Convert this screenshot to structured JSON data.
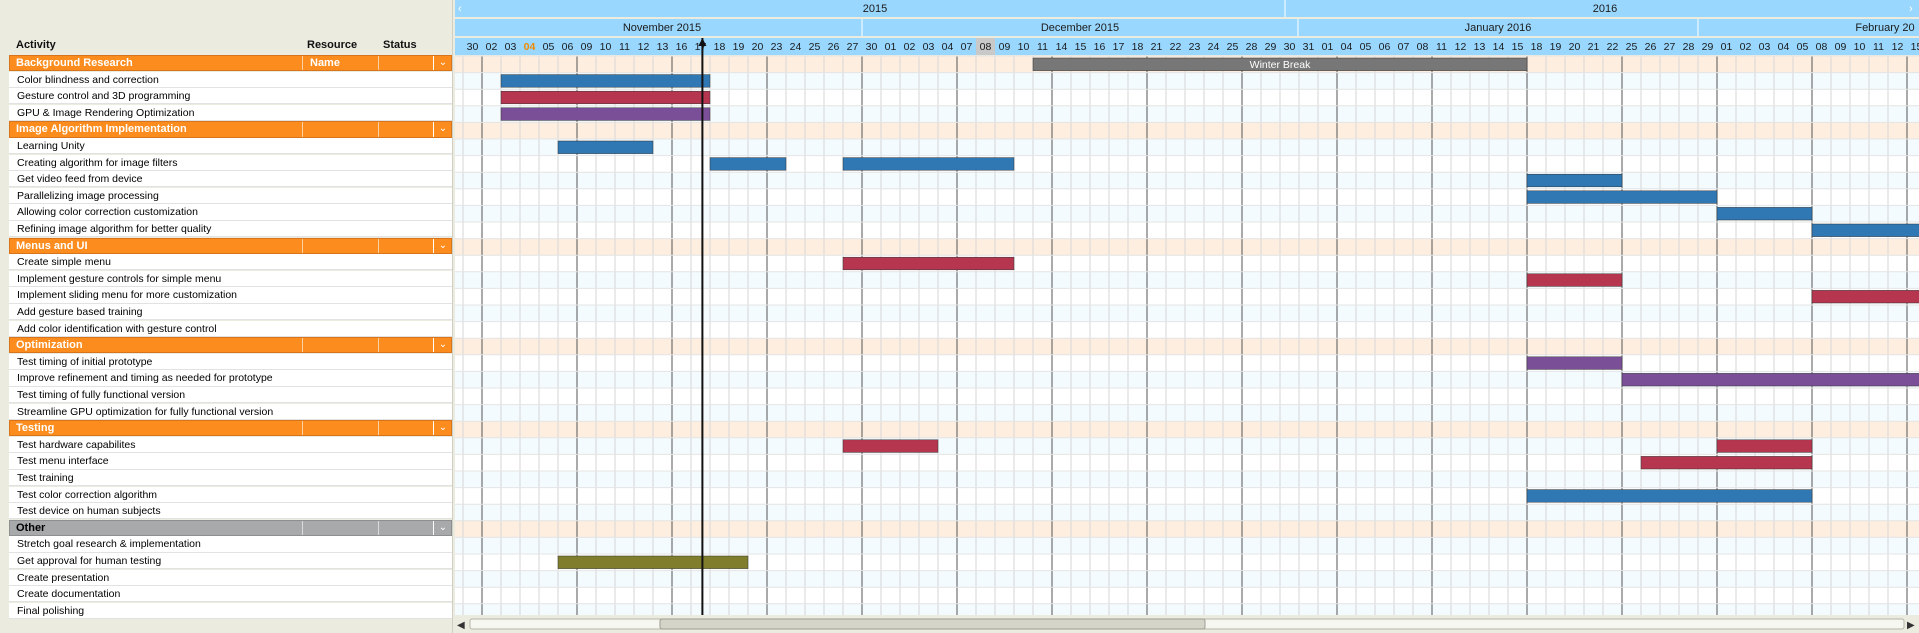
{
  "columns": {
    "activity": "Activity",
    "resource": "Resource",
    "status": "Status"
  },
  "timeline": {
    "years": [
      {
        "label": "2015"
      },
      {
        "label": "2016"
      }
    ],
    "months": [
      {
        "label": "November 2015"
      },
      {
        "label": "December 2015"
      },
      {
        "label": "January 2016"
      },
      {
        "label": "February 20"
      }
    ],
    "days": [
      "30",
      "02",
      "03",
      "04",
      "05",
      "06",
      "09",
      "10",
      "11",
      "12",
      "13",
      "16",
      "17",
      "18",
      "19",
      "20",
      "23",
      "24",
      "25",
      "26",
      "27",
      "30",
      "01",
      "02",
      "03",
      "04",
      "07",
      "08",
      "09",
      "10",
      "11",
      "14",
      "15",
      "16",
      "17",
      "18",
      "21",
      "22",
      "23",
      "24",
      "25",
      "28",
      "29",
      "30",
      "31",
      "01",
      "04",
      "05",
      "06",
      "07",
      "08",
      "11",
      "12",
      "13",
      "14",
      "15",
      "18",
      "19",
      "20",
      "21",
      "22",
      "25",
      "26",
      "27",
      "28",
      "29",
      "01",
      "02",
      "03",
      "04",
      "05",
      "08",
      "09",
      "10",
      "11",
      "12",
      "15",
      "16"
    ],
    "today_day": "04",
    "highlight_day": "08",
    "nav_prev": "‹",
    "nav_next": "›",
    "scroll_left": "◀",
    "scroll_right": "▶"
  },
  "groups": [
    {
      "name": "Background Research",
      "resource": "Name",
      "style": "orange",
      "activities": [
        "Color blindness and correction",
        "Gesture control and 3D programming",
        "GPU & Image Rendering Optimization"
      ]
    },
    {
      "name": "Image Algorithm Implementation",
      "style": "orange",
      "activities": [
        "Learning Unity",
        "Creating algorithm for image filters",
        "Get video feed from device",
        "Parallelizing image processing",
        "Allowing color correction customization",
        "Refining image algorithm for better quality"
      ]
    },
    {
      "name": "Menus and UI",
      "style": "orange",
      "activities": [
        "Create simple menu",
        "Implement gesture controls for simple menu",
        "Implement sliding menu for more customization",
        "Add gesture based training",
        "Add color identification with gesture control"
      ]
    },
    {
      "name": "Optimization",
      "style": "orange",
      "activities": [
        "Test timing of initial prototype",
        "Improve refinement and timing as needed for prototype",
        "Test timing of fully functional version",
        "Streamline GPU optimization for fully functional version"
      ]
    },
    {
      "name": "Testing",
      "style": "orange",
      "activities": [
        "Test hardware capabilites",
        "Test menu interface",
        "Test training",
        "Test color correction algorithm",
        "Test device on human subjects"
      ]
    },
    {
      "name": "Other",
      "style": "grey",
      "activities": [
        "Stretch goal research & implementation",
        "Get approval for human testing",
        "Create presentation",
        "Create documentation",
        "Final polishing"
      ]
    }
  ],
  "bars": [
    {
      "row": 0,
      "start": "2015-12-11",
      "end": "2016-01-15",
      "color": "grey",
      "label": "Winter Break"
    },
    {
      "row": 1,
      "start": "2015-11-03",
      "end": "2015-11-17",
      "color": "blue"
    },
    {
      "row": 2,
      "start": "2015-11-03",
      "end": "2015-11-17",
      "color": "red"
    },
    {
      "row": 3,
      "start": "2015-11-03",
      "end": "2015-11-17",
      "color": "purple"
    },
    {
      "row": 5,
      "start": "2015-11-06",
      "end": "2015-11-12",
      "color": "blue"
    },
    {
      "row": 6,
      "start": "2015-11-18",
      "end": "2015-11-23",
      "color": "blue"
    },
    {
      "row": 6,
      "start": "2015-11-27",
      "end": "2015-12-09",
      "color": "blue"
    },
    {
      "row": 7,
      "start": "2016-01-18",
      "end": "2016-01-22",
      "color": "blue"
    },
    {
      "row": 8,
      "start": "2016-01-18",
      "end": "2016-01-29",
      "color": "blue"
    },
    {
      "row": 9,
      "start": "2016-02-01",
      "end": "2016-02-05",
      "color": "blue"
    },
    {
      "row": 10,
      "start": "2016-02-08",
      "end": "2016-02-16",
      "color": "blue"
    },
    {
      "row": 12,
      "start": "2015-11-27",
      "end": "2015-12-09",
      "color": "red"
    },
    {
      "row": 13,
      "start": "2016-01-18",
      "end": "2016-01-22",
      "color": "red"
    },
    {
      "row": 14,
      "start": "2016-02-08",
      "end": "2016-02-16",
      "color": "red"
    },
    {
      "row": 18,
      "start": "2016-01-18",
      "end": "2016-01-22",
      "color": "purple"
    },
    {
      "row": 19,
      "start": "2016-01-25",
      "end": "2016-02-16",
      "color": "purple"
    },
    {
      "row": 23,
      "start": "2015-11-27",
      "end": "2015-12-03",
      "color": "red"
    },
    {
      "row": 24,
      "start": "2016-01-26",
      "end": "2016-02-05",
      "color": "red"
    },
    {
      "row": 23,
      "start": "2016-02-01",
      "end": "2016-02-05",
      "color": "red"
    },
    {
      "row": 26,
      "start": "2016-01-18",
      "end": "2016-02-05",
      "color": "blue"
    },
    {
      "row": 30,
      "start": "2015-11-06",
      "end": "2015-11-19",
      "color": "olive"
    }
  ],
  "colors": {
    "orange": "#fb8c1d",
    "grey": "#a7a9ab",
    "blue": "#2f78b4",
    "red": "#b63650",
    "purple": "#7a4f98",
    "olive": "#807e2c",
    "breakbar": "#777777",
    "header_blue": "#99d7ff",
    "today": "#f08a00"
  }
}
